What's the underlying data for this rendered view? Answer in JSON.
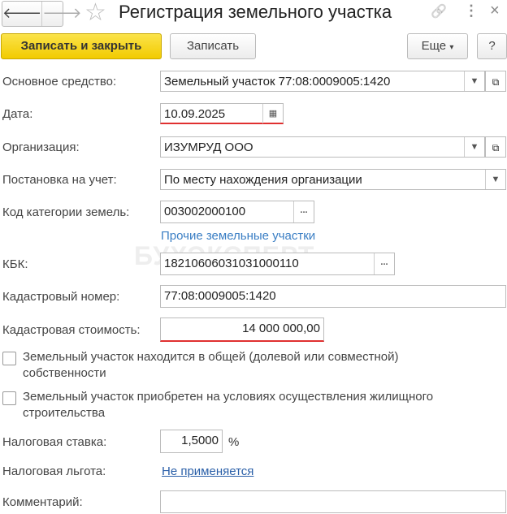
{
  "window": {
    "title": "Регистрация земельного участка",
    "back": "🡐",
    "forward": "🡒",
    "star": "☆",
    "link_icon": "🔗",
    "more_icon": "⋮",
    "close_icon": "×"
  },
  "toolbar": {
    "save_close": "Записать и закрыть",
    "save": "Записать",
    "more": "Еще",
    "more_arrow": "▾",
    "help": "?"
  },
  "watermark": "БУХЭКСПЕРТ",
  "form": {
    "asset": {
      "label": "Основное средство:",
      "value": "Земельный участок 77:08:0009005:1420"
    },
    "date": {
      "label": "Дата:",
      "value": "10.09.2025"
    },
    "org": {
      "label": "Организация:",
      "value": "ИЗУМРУД ООО"
    },
    "registration": {
      "label": "Постановка на учет:",
      "value": "По месту нахождения организации"
    },
    "land_category": {
      "label": "Код категории земель:",
      "value": "003002000100",
      "hint": "Прочие земельные участки"
    },
    "kbk": {
      "label": "КБК:",
      "value": "18210606031031000110"
    },
    "cadastral_number": {
      "label": "Кадастровый номер:",
      "value": "77:08:0009005:1420"
    },
    "cadastral_value": {
      "label": "Кадастровая стоимость:",
      "value": "14 000 000,00"
    },
    "shared_ownership": {
      "label": "Земельный участок находится в общей (долевой или совместной) собственности",
      "checked": false
    },
    "housing": {
      "label": "Земельный участок приобретен на условиях осуществления жилищного строительства",
      "checked": false
    },
    "tax_rate": {
      "label": "Налоговая ставка:",
      "value": "1,5000",
      "unit": "%"
    },
    "tax_benefit": {
      "label": "Налоговая льгота:",
      "value": "Не применяется"
    },
    "comment": {
      "label": "Комментарий:",
      "value": ""
    }
  }
}
